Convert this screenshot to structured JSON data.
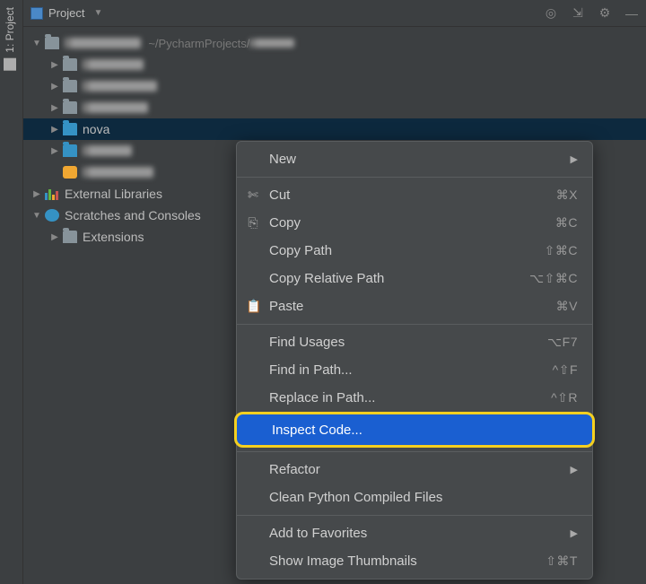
{
  "sidebar": {
    "tab_label": "1: Project"
  },
  "panel": {
    "title": "Project",
    "header_icons": [
      "target-icon",
      "collapse-icon",
      "gear-icon",
      "minimize-icon"
    ]
  },
  "tree": {
    "root_path": "~/PycharmProjects/",
    "nodes": [
      {
        "label": "████",
        "blur": true,
        "depth": 0,
        "expanded": true,
        "icon": "folder-gray",
        "path": "~/PycharmProjects/████"
      },
      {
        "label": "████",
        "blur": true,
        "depth": 1,
        "expanded": false,
        "icon": "folder-gray"
      },
      {
        "label": "████",
        "blur": true,
        "depth": 1,
        "expanded": false,
        "icon": "folder-gray"
      },
      {
        "label": "████",
        "blur": true,
        "depth": 1,
        "expanded": false,
        "icon": "folder-gray"
      },
      {
        "label": "nova",
        "blur": false,
        "depth": 1,
        "expanded": false,
        "icon": "folder-blue",
        "selected": true
      },
      {
        "label": "████",
        "blur": true,
        "depth": 1,
        "expanded": false,
        "icon": "folder-blue"
      },
      {
        "label": "████",
        "blur": true,
        "depth": 1,
        "expanded": null,
        "icon": "py-file"
      },
      {
        "label": "External Libraries",
        "blur": false,
        "depth": 0,
        "expanded": false,
        "icon": "libraries"
      },
      {
        "label": "Scratches and Consoles",
        "blur": false,
        "depth": 0,
        "expanded": true,
        "icon": "scratches"
      },
      {
        "label": "Extensions",
        "blur": false,
        "depth": 1,
        "expanded": false,
        "icon": "folder-gray"
      }
    ]
  },
  "context_menu": {
    "groups": [
      [
        {
          "label": "New",
          "submenu": true
        }
      ],
      [
        {
          "label": "Cut",
          "icon": "✄",
          "shortcut": "⌘X"
        },
        {
          "label": "Copy",
          "icon": "⎘",
          "shortcut": "⌘C"
        },
        {
          "label": "Copy Path",
          "shortcut": "⇧⌘C"
        },
        {
          "label": "Copy Relative Path",
          "shortcut": "⌥⇧⌘C"
        },
        {
          "label": "Paste",
          "icon": "📋",
          "shortcut": "⌘V"
        }
      ],
      [
        {
          "label": "Find Usages",
          "shortcut": "⌥F7"
        },
        {
          "label": "Find in Path...",
          "shortcut": "^⇧F"
        },
        {
          "label": "Replace in Path...",
          "shortcut": "^⇧R"
        },
        {
          "label": "Inspect Code...",
          "highlighted": true
        }
      ],
      [
        {
          "label": "Refactor",
          "submenu": true
        },
        {
          "label": "Clean Python Compiled Files"
        }
      ],
      [
        {
          "label": "Add to Favorites",
          "submenu": true
        },
        {
          "label": "Show Image Thumbnails",
          "shortcut": "⇧⌘T"
        }
      ]
    ]
  }
}
